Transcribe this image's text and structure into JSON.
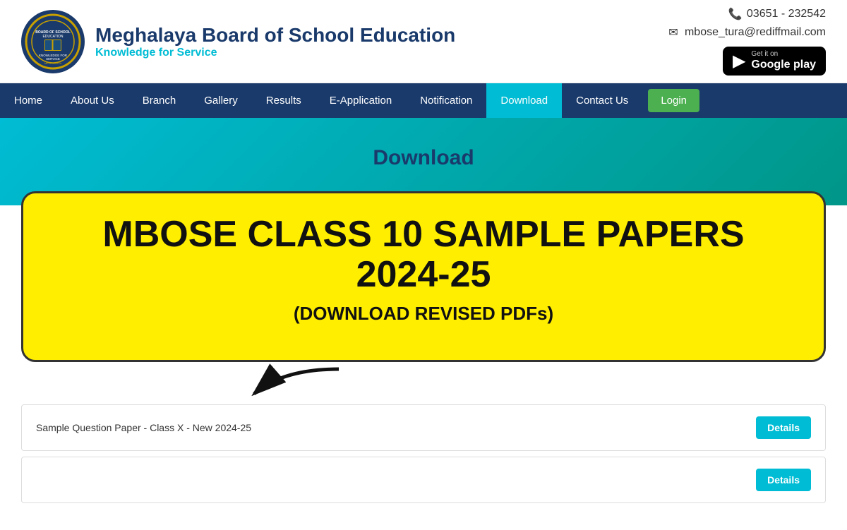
{
  "header": {
    "logo_alt": "Meghalaya Board of School Education logo",
    "title": "Meghalaya Board of School Education",
    "tagline": "Knowledge for Service",
    "phone": "03651 - 232542",
    "email": "mbose_tura@rediffmail.com",
    "google_play": {
      "get_it_on": "Get it on",
      "label": "Google play"
    }
  },
  "navbar": {
    "items": [
      {
        "label": "Home",
        "active": false
      },
      {
        "label": "About Us",
        "active": false
      },
      {
        "label": "Branch",
        "active": false
      },
      {
        "label": "Gallery",
        "active": false
      },
      {
        "label": "Results",
        "active": false
      },
      {
        "label": "E-Application",
        "active": false
      },
      {
        "label": "Notification",
        "active": false
      },
      {
        "label": "Download",
        "active": true
      },
      {
        "label": "Contact Us",
        "active": false
      }
    ],
    "login_label": "Login"
  },
  "page_title": "Download",
  "announcement": {
    "heading": "MBOSE CLASS 10 SAMPLE PAPERS 2024-25",
    "subtext": "(DOWNLOAD REVISED PDFs)"
  },
  "table": {
    "rows": [
      {
        "label": "Sample Question Paper - Class X - New 2024-25",
        "button": "Details"
      },
      {
        "label": "",
        "button": "Details"
      }
    ]
  },
  "icons": {
    "phone": "📞",
    "email": "✉",
    "play_triangle": "▶"
  }
}
